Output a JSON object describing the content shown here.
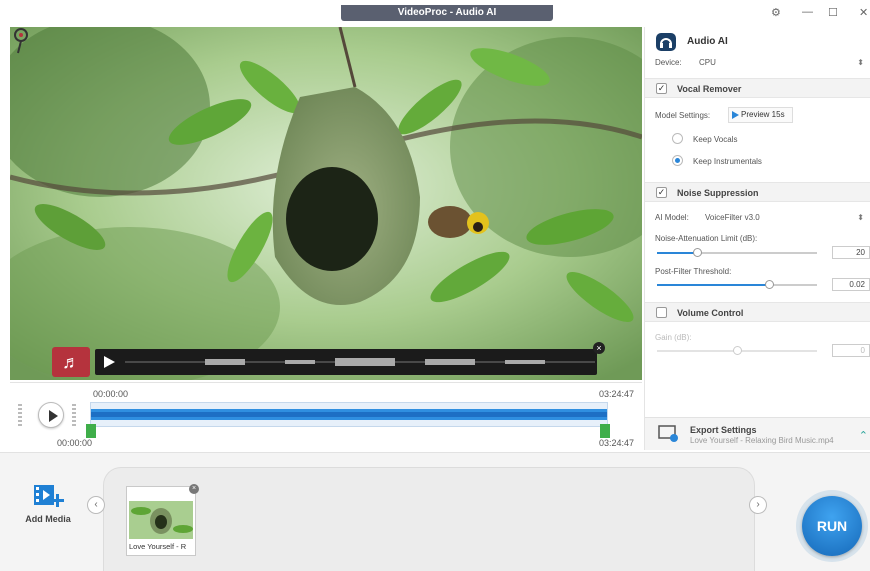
{
  "app": {
    "title": "VideoProc - Audio AI"
  },
  "window_controls": {
    "settings": "⚙",
    "minimize": "—",
    "maximize": "☐",
    "close": "✕"
  },
  "timeline": {
    "start_time_top": "00:00:00",
    "end_time_top": "03:24:47",
    "start_time_bottom": "00:00:00",
    "end_time_bottom": "03:24:47"
  },
  "panel": {
    "title": "Audio AI",
    "device": {
      "label": "Device:",
      "value": "CPU"
    },
    "vocal_remover": {
      "title": "Vocal Remover",
      "checked": true,
      "model_settings_label": "Model Settings:",
      "preview_label": "Preview 15s",
      "options": [
        {
          "label": "Keep Vocals",
          "selected": false
        },
        {
          "label": "Keep Instrumentals",
          "selected": true
        }
      ]
    },
    "noise_suppression": {
      "title": "Noise Suppression",
      "checked": true,
      "ai_model_label": "AI Model:",
      "ai_model_value": "VoiceFilter v3.0",
      "attenuation_label": "Noise-Attenuation Limit (dB):",
      "attenuation_value": "20",
      "attenuation_fraction": 0.25,
      "postfilter_label": "Post-Filter Threshold:",
      "postfilter_value": "0.02",
      "postfilter_fraction": 0.7
    },
    "volume_control": {
      "title": "Volume Control",
      "checked": false,
      "gain_label": "Gain (dB):",
      "gain_value": "0",
      "gain_fraction": 0.5
    },
    "export": {
      "title": "Export Settings",
      "filename": "Love Yourself - Relaxing Bird Music.mp4"
    }
  },
  "media": {
    "add_label": "Add Media",
    "items": [
      {
        "caption": "Love Yourself - R"
      }
    ]
  },
  "run_label": "RUN",
  "colors": {
    "accent": "#2a86d8",
    "record_red": "#b5333d",
    "handle_green": "#3fae4a",
    "run_blue": "#1f7fd1"
  }
}
